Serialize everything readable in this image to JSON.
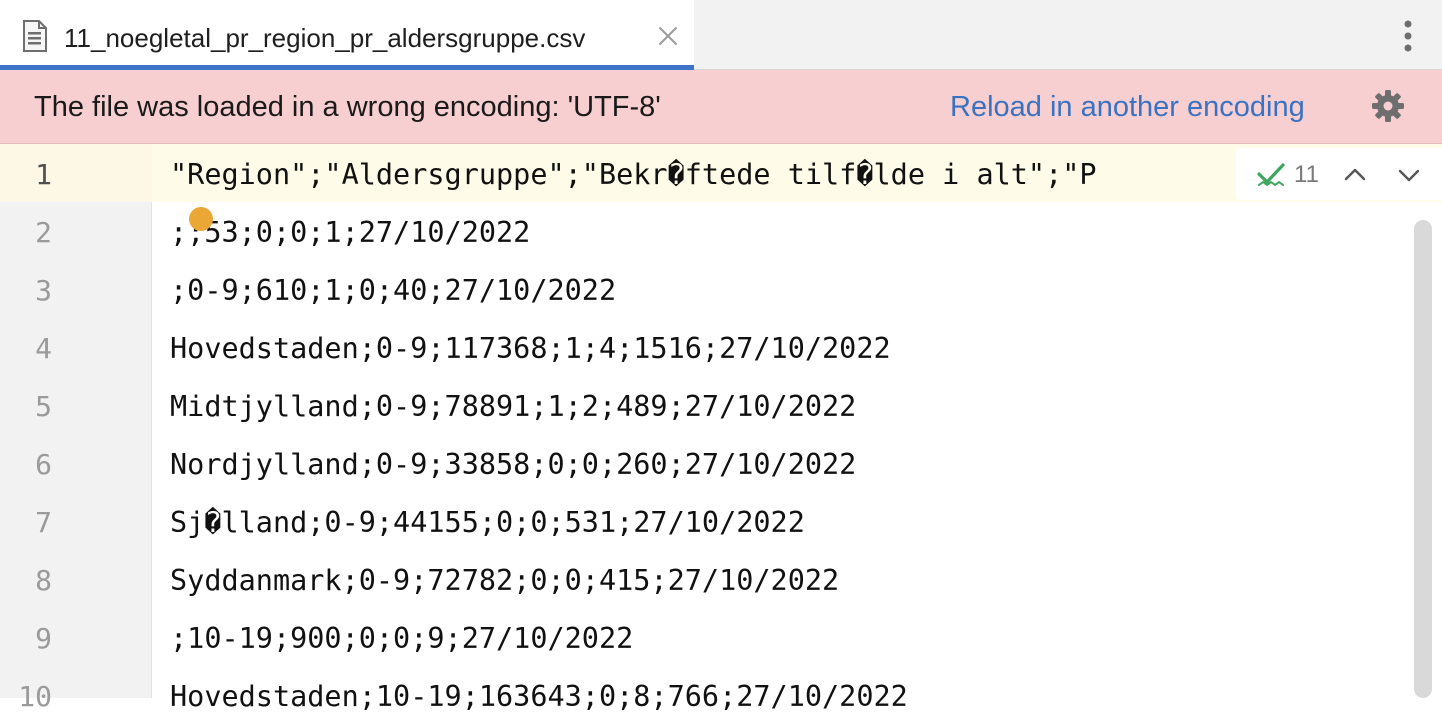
{
  "tab": {
    "title": "11_noegletal_pr_region_pr_aldersgruppe.csv",
    "file_icon": "text-file-icon",
    "close_icon": "close-icon",
    "more_icon": "more-vertical-icon"
  },
  "banner": {
    "message": "The file was loaded in a wrong encoding: 'UTF-8'",
    "link": "Reload in another encoding",
    "settings_icon": "gear-icon"
  },
  "inspection": {
    "count": "11",
    "icon": "check-icon"
  },
  "lines": [
    {
      "number": "1",
      "text": "\"Region\";\"Aldersgruppe\";\"Bekr�ftede tilf�lde i alt\";\"P"
    },
    {
      "number": "2",
      "text": ";;53;0;0;1;27/10/2022"
    },
    {
      "number": "3",
      "text": ";0-9;610;1;0;40;27/10/2022"
    },
    {
      "number": "4",
      "text": "Hovedstaden;0-9;117368;1;4;1516;27/10/2022"
    },
    {
      "number": "5",
      "text": "Midtjylland;0-9;78891;1;2;489;27/10/2022"
    },
    {
      "number": "6",
      "text": "Nordjylland;0-9;33858;0;0;260;27/10/2022"
    },
    {
      "number": "7",
      "text": "Sj�lland;0-9;44155;0;0;531;27/10/2022"
    },
    {
      "number": "8",
      "text": "Syddanmark;0-9;72782;0;0;415;27/10/2022"
    },
    {
      "number": "9",
      "text": ";10-19;900;0;0;9;27/10/2022"
    },
    {
      "number": "10",
      "text": "Hovedstaden;10-19;163643;0;8;766;27/10/2022"
    }
  ],
  "colors": {
    "accent": "#3d74c7",
    "banner_bg": "#f7cfd0",
    "link": "#3a72c3",
    "bulb": "#eaa735",
    "check": "#3ea55c"
  }
}
